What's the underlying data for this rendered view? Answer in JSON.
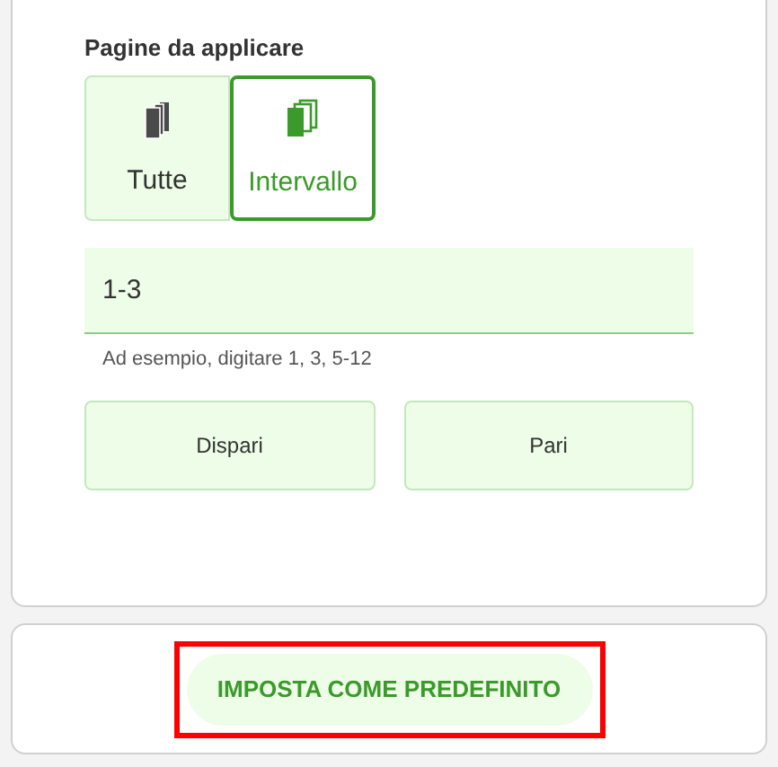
{
  "section_title": "Pagine da applicare",
  "page_modes": [
    {
      "label": "Tutte",
      "selected": false
    },
    {
      "label": "Intervallo",
      "selected": true
    }
  ],
  "range_field": {
    "value": "1-3",
    "hint": "Ad esempio, digitare 1, 3, 5-12"
  },
  "parity_buttons": [
    "Dispari",
    "Pari"
  ],
  "default_button": {
    "label": "IMPOSTA COME PREDEFINITO",
    "highlighted": true
  }
}
